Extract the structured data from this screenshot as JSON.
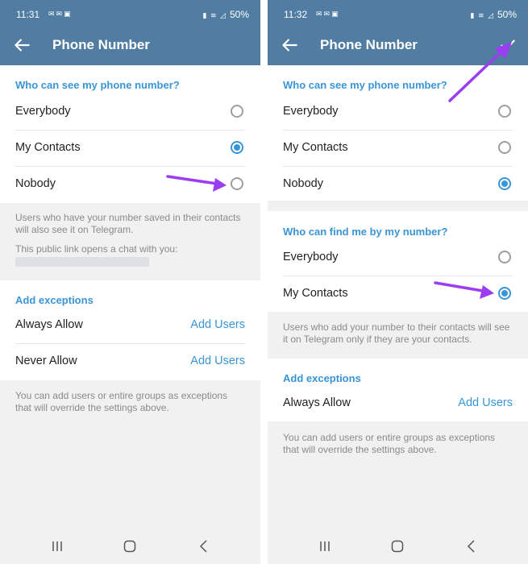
{
  "colors": {
    "accent": "#3a95d5",
    "header": "#517da2",
    "annotation_arrow": "#9b3df0"
  },
  "status_bar": [
    {
      "time": "11:31",
      "battery": "50%"
    },
    {
      "time": "11:32",
      "battery": "50%"
    }
  ],
  "screens": [
    {
      "title": "Phone Number",
      "section1": {
        "header": "Who can see my phone number?",
        "options": [
          {
            "label": "Everybody",
            "selected": false
          },
          {
            "label": "My Contacts",
            "selected": true
          },
          {
            "label": "Nobody",
            "selected": false
          }
        ]
      },
      "info1": "Users who have your number saved in their contacts will also see it on Telegram.",
      "info2": "This public link opens a chat with you:",
      "exceptions": {
        "header": "Add exceptions",
        "rows": [
          {
            "label": "Always Allow",
            "action": "Add Users"
          },
          {
            "label": "Never Allow",
            "action": "Add Users"
          }
        ]
      },
      "footer": "You can add users or entire groups as exceptions that will override the settings above."
    },
    {
      "title": "Phone Number",
      "section1": {
        "header": "Who can see my phone number?",
        "options": [
          {
            "label": "Everybody",
            "selected": false
          },
          {
            "label": "My Contacts",
            "selected": false
          },
          {
            "label": "Nobody",
            "selected": true
          }
        ]
      },
      "section2": {
        "header": "Who can find me by my number?",
        "options": [
          {
            "label": "Everybody",
            "selected": false
          },
          {
            "label": "My Contacts",
            "selected": true
          }
        ]
      },
      "info": "Users who add your number to their contacts will see it on Telegram only if they are your contacts.",
      "exceptions": {
        "header": "Add exceptions",
        "rows": [
          {
            "label": "Always Allow",
            "action": "Add Users"
          }
        ]
      },
      "footer": "You can add users or entire groups as exceptions that will override the settings above."
    }
  ]
}
